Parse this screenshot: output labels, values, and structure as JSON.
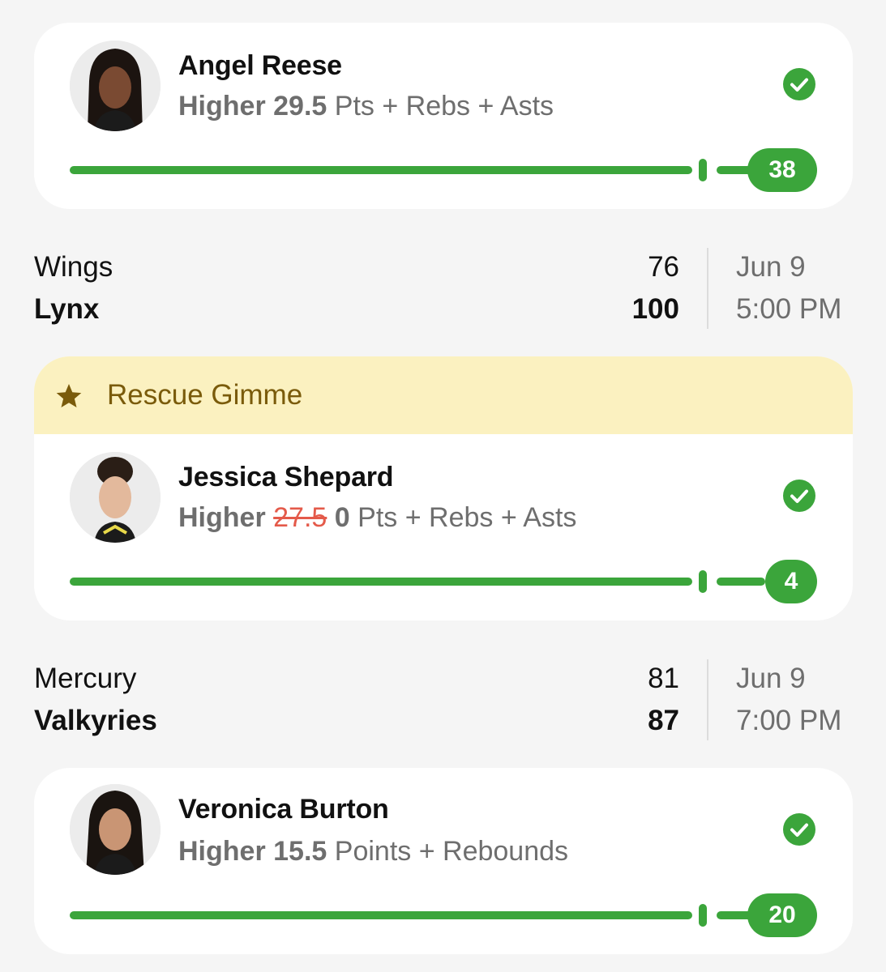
{
  "picks": [
    {
      "player": "Angel Reese",
      "direction": "Higher",
      "line": "29.5",
      "stat": "Pts + Rebs + Asts",
      "result": "38",
      "status_icon": "check-circle-icon"
    },
    {
      "banner": "Rescue Gimme",
      "banner_icon": "star-icon",
      "player": "Jessica Shepard",
      "direction": "Higher",
      "original_line": "27.5",
      "line": "0",
      "stat": "Pts + Rebs + Asts",
      "result": "4",
      "status_icon": "check-circle-icon"
    },
    {
      "player": "Veronica Burton",
      "direction": "Higher",
      "line": "15.5",
      "stat": "Points + Rebounds",
      "result": "20",
      "status_icon": "check-circle-icon"
    }
  ],
  "games": [
    {
      "away": "Wings",
      "away_score": "76",
      "home": "Lynx",
      "home_score": "100",
      "date": "Jun 9",
      "time": "5:00 PM"
    },
    {
      "away": "Mercury",
      "away_score": "81",
      "home": "Valkyries",
      "home_score": "87",
      "date": "Jun 9",
      "time": "7:00 PM"
    }
  ],
  "colors": {
    "success": "#3ba53b",
    "banner_bg": "#fbf1c0",
    "banner_text": "#7a5b0b",
    "strike": "#e45a4a"
  }
}
